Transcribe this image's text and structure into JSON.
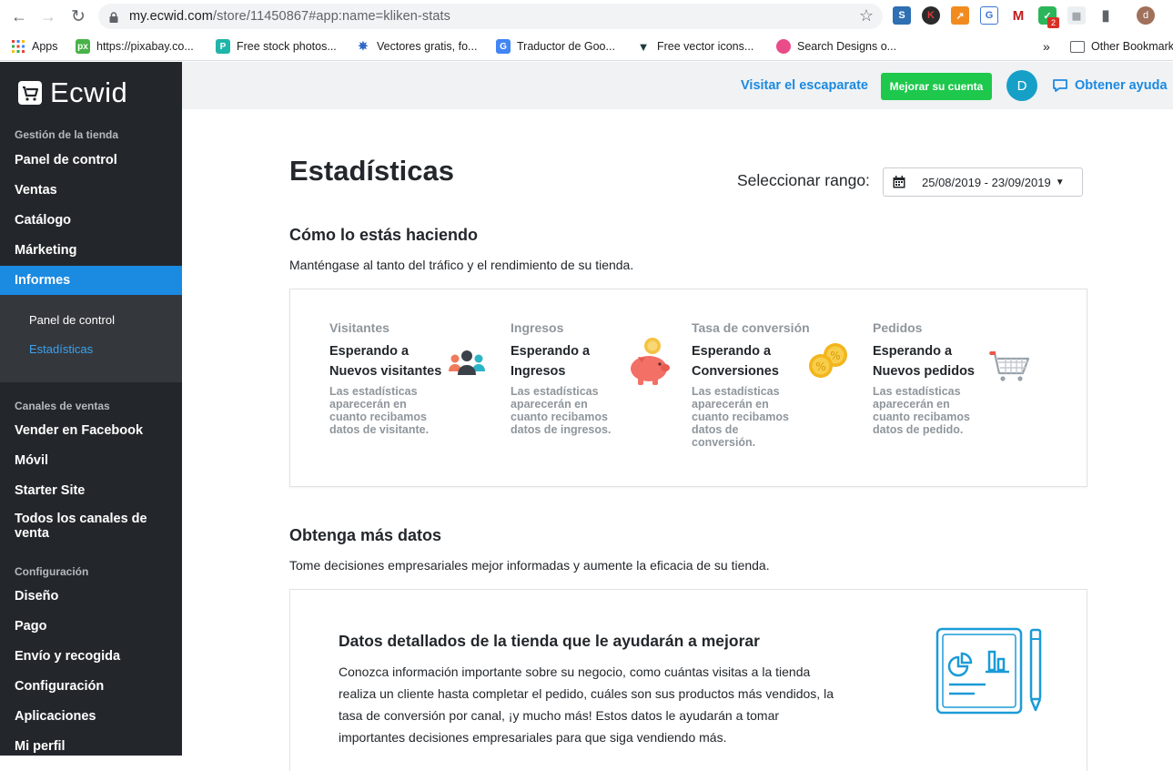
{
  "browser": {
    "url_host": "my.ecwid.com",
    "url_path": "/store/11450867#app:name=kliken-stats",
    "profile_initial": "d",
    "ext_badge": "2"
  },
  "bookmarks": {
    "apps": "Apps",
    "items": [
      "https://pixabay.co...",
      "Free stock photos...",
      "Vectores gratis, fo...",
      "Traductor de Goo...",
      "Free vector icons...",
      "Search Designs o..."
    ],
    "overflow": "»",
    "other": "Other Bookmarks"
  },
  "sidebar": {
    "logo": "Ecwid",
    "section_store": "Gestión de la tienda",
    "store_items": [
      "Panel de control",
      "Ventas",
      "Catálogo",
      "Márketing",
      "Informes"
    ],
    "sub_items": [
      "Panel de control",
      "Estadísticas"
    ],
    "section_channels": "Canales de ventas",
    "channel_items": [
      "Vender en Facebook",
      "Móvil",
      "Starter Site",
      "Todos los canales de venta"
    ],
    "section_config": "Configuración",
    "config_items": [
      "Diseño",
      "Pago",
      "Envío y recogida",
      "Configuración",
      "Aplicaciones",
      "Mi perfil"
    ]
  },
  "topbar": {
    "visit_store": "Visitar el escaparate",
    "upgrade": "Mejorar su cuenta",
    "avatar_initial": "D",
    "help": "Obtener ayuda"
  },
  "main": {
    "title": "Estadísticas",
    "range_label": "Seleccionar rango:",
    "range_value": "25/08/2019 - 23/09/2019",
    "performance_title": "Cómo lo estás haciendo",
    "performance_desc": "Manténgase al tanto del tráfico y el rendimiento de su tienda.",
    "stats": [
      {
        "title": "Visitantes",
        "waiting": "Esperando a Nuevos visitantes",
        "desc": "Las estadísticas aparecerán en cuanto recibamos datos de visitante."
      },
      {
        "title": "Ingresos",
        "waiting": "Esperando a Ingresos",
        "desc": "Las estadísticas aparecerán en cuanto recibamos datos de ingresos."
      },
      {
        "title": "Tasa de conversión",
        "waiting": "Esperando a Conversiones",
        "desc": "Las estadísticas aparecerán en cuanto recibamos datos de conversión."
      },
      {
        "title": "Pedidos",
        "waiting": "Esperando a Nuevos pedidos",
        "desc": "Las estadísticas aparecerán en cuanto recibamos datos de pedido."
      }
    ],
    "more_title": "Obtenga más datos",
    "more_desc": "Tome decisiones empresariales mejor informadas y aumente la eficacia de su tienda.",
    "promo_title": "Datos detallados de la tienda que le ayudarán a mejorar",
    "promo_body": "Conozca información importante sobre su negocio, como cuántas visitas a la tienda realiza un cliente hasta completar el pedido, cuáles son sus productos más vendidos, la tasa de conversión por canal, ¡y mucho más! Estos datos le ayudarán a tomar importantes decisiones empresariales para que siga vendiendo más."
  },
  "colors": {
    "sidebar_bg": "#23272b",
    "accent": "#1b8ae1",
    "upgrade_green": "#1ec84c",
    "avatar": "#16a0c8"
  }
}
